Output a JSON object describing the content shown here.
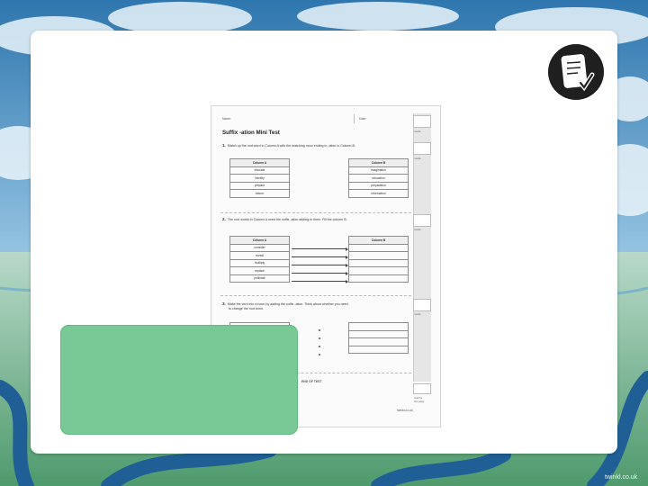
{
  "worksheet": {
    "name_label": "Name:",
    "date_label": "Date:",
    "title": "Suffix -ation Mini Test",
    "q1": {
      "number": "1.",
      "text": "Match up the root word in Column A with the matching noun ending in -ation in Column B.",
      "column_a_header": "Column A",
      "column_b_header": "Column B",
      "column_a": [
        "educate",
        "identify",
        "prepare",
        "inform"
      ],
      "column_b": [
        "imagination",
        "education",
        "preparation",
        "information"
      ]
    },
    "q2": {
      "number": "2.",
      "text": "The root words in Column A need the suffix -ation adding to them. Fill the column B.",
      "column_a_header": "Column A",
      "column_b_header": "Column B",
      "column_a": [
        "consider",
        "reveal",
        "multiply",
        "replace",
        "pollinate"
      ]
    },
    "q3": {
      "number": "3.",
      "text_line1": "Make the verb into a noun by adding the suffix -ation. Think about whether you need",
      "text_line2": "to change the root word."
    },
    "end_text": "END OF TEST",
    "footer_text": "twinkl.co.uk",
    "margin_labels": [
      "marks",
      "marks",
      "marks",
      "marks"
    ],
    "total_label_line1": "total for",
    "total_label_line2": "this page"
  },
  "watermark": "twinkl.co.uk",
  "colors": {
    "panel": "#ffffff",
    "green_box": "#79c996",
    "sky": "#3b7fb6",
    "river": "#1f5f95"
  },
  "icons": {
    "badge": "test-paper-checkmark-icon"
  }
}
